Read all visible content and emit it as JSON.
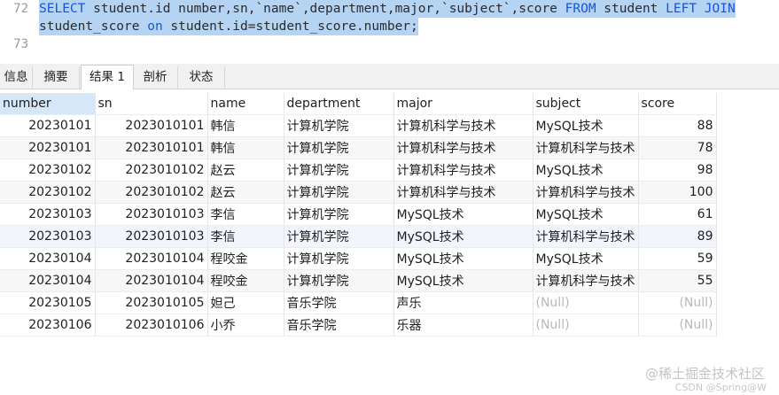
{
  "editor": {
    "lines": [
      {
        "no": "72",
        "kw1": "SELECT",
        "part1": " student.id number,sn,`name`,department,major,`subject`,score ",
        "kw2": "FROM",
        "part2": " student ",
        "kw3": "LEFT JOIN"
      },
      {
        "no": "",
        "part1": "student_score ",
        "kw1": "on",
        "part2": " student.id=student_score.number;"
      },
      {
        "no": "73"
      }
    ]
  },
  "tabs": [
    {
      "label": "信息"
    },
    {
      "label": "摘要"
    },
    {
      "label": "结果 1"
    },
    {
      "label": "剖析"
    },
    {
      "label": "状态"
    }
  ],
  "table": {
    "columns": [
      "number",
      "sn",
      "name",
      "department",
      "major",
      "subject",
      "score"
    ],
    "rows": [
      [
        "20230101",
        "2023010101",
        "韩信",
        "计算机学院",
        "计算机科学与技术",
        "MySQL技术",
        "88"
      ],
      [
        "20230101",
        "2023010101",
        "韩信",
        "计算机学院",
        "计算机科学与技术",
        "计算机科学与技术",
        "78"
      ],
      [
        "20230102",
        "2023010102",
        "赵云",
        "计算机学院",
        "计算机科学与技术",
        "MySQL技术",
        "98"
      ],
      [
        "20230102",
        "2023010102",
        "赵云",
        "计算机学院",
        "计算机科学与技术",
        "计算机科学与技术",
        "100"
      ],
      [
        "20230103",
        "2023010103",
        "李信",
        "计算机学院",
        "MySQL技术",
        "MySQL技术",
        "61"
      ],
      [
        "20230103",
        "2023010103",
        "李信",
        "计算机学院",
        "MySQL技术",
        "计算机科学与技术",
        "89"
      ],
      [
        "20230104",
        "2023010104",
        "程咬金",
        "计算机学院",
        "MySQL技术",
        "MySQL技术",
        "59"
      ],
      [
        "20230104",
        "2023010104",
        "程咬金",
        "计算机学院",
        "MySQL技术",
        "计算机科学与技术",
        "55"
      ],
      [
        "20230105",
        "2023010105",
        "妲己",
        "音乐学院",
        "声乐",
        "(Null)",
        "(Null)"
      ],
      [
        "20230106",
        "2023010106",
        "小乔",
        "音乐学院",
        "乐器",
        "(Null)",
        "(Null)"
      ]
    ]
  },
  "watermark": {
    "main": "@稀土掘金技术社区",
    "sub": "CSDN @Spring@W"
  }
}
